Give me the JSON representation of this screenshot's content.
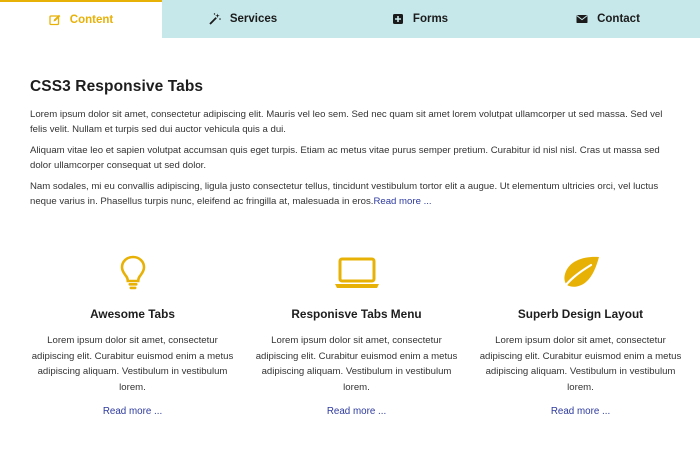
{
  "tabs": [
    {
      "label": "Content",
      "icon": "pencil-square-icon",
      "active": true
    },
    {
      "label": "Services",
      "icon": "magic-wand-icon"
    },
    {
      "label": "Forms",
      "icon": "plus-square-icon"
    },
    {
      "label": "Contact",
      "icon": "envelope-icon"
    }
  ],
  "content": {
    "title": "CSS3 Responsive Tabs",
    "paragraphs": [
      "Lorem ipsum dolor sit amet, consectetur adipiscing elit. Mauris vel leo sem. Sed nec quam sit amet lorem volutpat ullamcorper ut sed massa. Sed vel felis velit. Nullam et turpis sed dui auctor vehicula quis a dui.",
      "Aliquam vitae leo et sapien volutpat accumsan quis eget turpis. Etiam ac metus vitae purus semper pretium. Curabitur id nisl nisl. Cras ut massa sed dolor ullamcorper consequat ut sed dolor.",
      "Nam sodales, mi eu convallis adipiscing, ligula justo consectetur tellus, tincidunt vestibulum tortor elit a augue. Ut elementum ultricies orci, vel luctus neque varius in. Phasellus turpis nunc, eleifend ac fringilla at, malesuada in eros."
    ],
    "read_more": "Read more ..."
  },
  "features": [
    {
      "icon": "lightbulb-icon",
      "title": "Awesome Tabs",
      "desc": "Lorem ipsum dolor sit amet, consectetur adipiscing elit. Curabitur euismod enim a metus adipiscing aliquam. Vestibulum in vestibulum lorem.",
      "more": "Read more ..."
    },
    {
      "icon": "laptop-icon",
      "title": "Responisve Tabs Menu",
      "desc": "Lorem ipsum dolor sit amet, consectetur adipiscing elit. Curabitur euismod enim a metus adipiscing aliquam. Vestibulum in vestibulum lorem.",
      "more": "Read more ..."
    },
    {
      "icon": "leaf-icon",
      "title": "Superb Design Layout",
      "desc": "Lorem ipsum dolor sit amet, consectetur adipiscing elit. Curabitur euismod enim a metus adipiscing aliquam. Vestibulum in vestibulum lorem.",
      "more": "Read more ..."
    }
  ],
  "colors": {
    "accent": "#e8b106",
    "tab_bar": "#c6e8ea",
    "link": "#2d3a9e"
  }
}
